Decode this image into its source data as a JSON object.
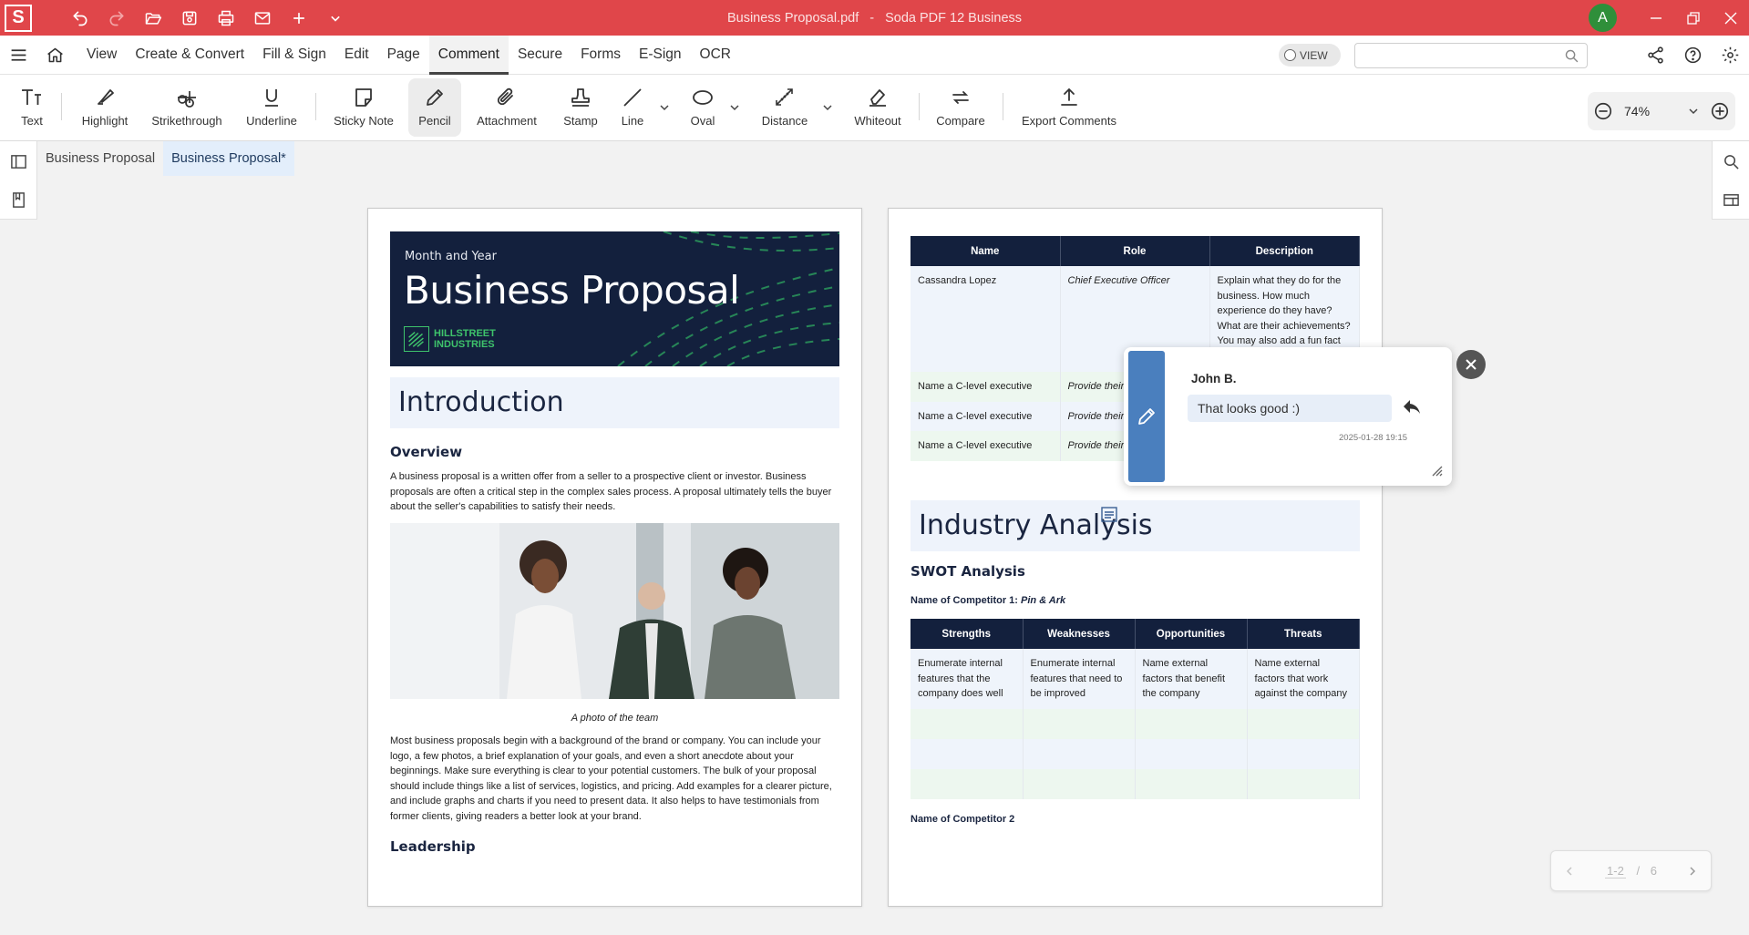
{
  "app": {
    "logo_letter": "S",
    "file_name": "Business Proposal.pdf",
    "separator": "-",
    "app_name": "Soda PDF 12 Business",
    "user_initial": "A",
    "colors": {
      "brand": "#e0464a",
      "avatar": "#2f8f3a",
      "accent_blue": "#4a7fbe",
      "navy": "#13203d"
    }
  },
  "menu": {
    "items": [
      {
        "label": "View"
      },
      {
        "label": "Create & Convert"
      },
      {
        "label": "Fill & Sign"
      },
      {
        "label": "Edit"
      },
      {
        "label": "Page"
      },
      {
        "label": "Comment"
      },
      {
        "label": "Secure"
      },
      {
        "label": "Forms"
      },
      {
        "label": "E-Sign"
      },
      {
        "label": "OCR"
      }
    ],
    "active": "Comment",
    "view_toggle": "VIEW",
    "search_value": "",
    "search_placeholder": ""
  },
  "toolbar": {
    "text": "Text",
    "highlight": "Highlight",
    "strikethrough": "Strikethrough",
    "underline": "Underline",
    "sticky_note": "Sticky Note",
    "pencil": "Pencil",
    "attachment": "Attachment",
    "stamp": "Stamp",
    "line": "Line",
    "oval": "Oval",
    "distance": "Distance",
    "whiteout": "Whiteout",
    "compare": "Compare",
    "export_comments": "Export Comments",
    "active_tool": "Pencil",
    "zoom": "74%"
  },
  "tabs": [
    {
      "label": "Business Proposal"
    },
    {
      "label": "Business Proposal*"
    }
  ],
  "page1": {
    "hero_kicker": "Month and Year",
    "hero_title": "Business Proposal",
    "brand_line1": "HILLSTREET",
    "brand_line2": "INDUSTRIES",
    "intro_heading": "Introduction",
    "overview_heading": "Overview",
    "overview_text": "A business proposal is a written offer from a seller to a prospective client or investor. Business proposals are often a critical step in the complex sales process. A proposal ultimately tells the buyer about the seller's capabilities to satisfy their needs.",
    "photo_caption": "A photo of the team",
    "body_text": "Most business proposals begin with a background of the brand or company. You can include your logo, a few photos, a brief explanation of your goals, and even a short anecdote about your beginnings. Make sure everything is clear to your potential customers. The bulk of your proposal should include things like a list of services, logistics, and pricing. Add examples for a clearer picture, and include graphs and charts if you need to present data. It also helps to have testimonials from former clients, giving readers a better look at your brand.",
    "leadership_heading": "Leadership"
  },
  "page2": {
    "team_headers": [
      "Name",
      "Role",
      "Description"
    ],
    "team_rows": [
      {
        "name": "Cassandra Lopez",
        "role": "Chief Executive Officer",
        "description": "Explain what they do for the business. How much experience do they have? What are their achievements? You may also add a fun fact"
      },
      {
        "name": "Name a C-level executive",
        "role": "Provide their",
        "description": ""
      },
      {
        "name": "Name a C-level executive",
        "role": "Provide their",
        "description": ""
      },
      {
        "name": "Name a C-level executive",
        "role": "Provide their",
        "description": ""
      }
    ],
    "industry_heading": "Industry Analysis",
    "swot_heading": "SWOT Analysis",
    "competitor1_label": "Name of Competitor 1:",
    "competitor1_name": "Pin & Ark",
    "swot_headers": [
      "Strengths",
      "Weaknesses",
      "Opportunities",
      "Threats"
    ],
    "swot_row": [
      "Enumerate internal features that the company does well",
      "Enumerate internal features that need to be improved",
      "Name external factors that benefit the company",
      "Name external factors that work against the company"
    ],
    "competitor2_label": "Name of Competitor 2"
  },
  "comment": {
    "author": "John B.",
    "text": "That looks good :)",
    "timestamp": "2025-01-28 19:15"
  },
  "pager": {
    "current": "1-2",
    "separator": "/",
    "total": "6"
  }
}
